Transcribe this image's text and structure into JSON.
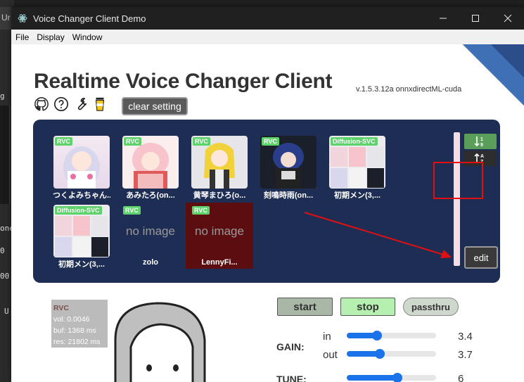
{
  "background": {
    "tab_text": "Ur",
    "side_texts": [
      "g",
      "one",
      "0",
      "00",
      "U"
    ]
  },
  "window": {
    "title": "Voice Changer Client Demo"
  },
  "menu": [
    "File",
    "Display",
    "Window"
  ],
  "header": {
    "title": "Realtime Voice Changer Client",
    "version": "v.1.5.3.12a  onnxdirectML-cuda",
    "icons": [
      "github-icon",
      "help-icon",
      "wrench-icon",
      "coffee-icon"
    ],
    "clear_setting": "clear setting"
  },
  "models": [
    {
      "badge": "RVC",
      "label": "つくよみちゃん..."
    },
    {
      "badge": "RVC",
      "label": "あみたろ(on..."
    },
    {
      "badge": "RVC",
      "label": "黄琴まひろ(o..."
    },
    {
      "badge": "RVC",
      "label": "刻鳴時雨(on..."
    },
    {
      "badge": "Diffusion-SVC",
      "label": "初期メン(3,..."
    },
    {
      "badge": "Diffusion-SVC",
      "label": "初期メン(3,..."
    },
    {
      "badge": "RVC",
      "label": "zolo",
      "image_text": "no image"
    },
    {
      "badge": "RVC",
      "label": "LennyFi...",
      "image_text": "no image"
    }
  ],
  "panel": {
    "sort_up_icon": "sort-desc-icon",
    "sort_down_icon": "sort-asc-icon",
    "edit": "edit"
  },
  "stats": {
    "model_type": "RVC",
    "vol": "vol: 0.0046",
    "buf": "buf: 1368 ms",
    "res": "res: 21802 ms"
  },
  "controls": {
    "start": "start",
    "stop": "stop",
    "passthru": "passthru",
    "gain_label": "GAIN:",
    "in_label": "in",
    "out_label": "out",
    "gain_in": "3.4",
    "gain_out": "3.7",
    "tune_label": "TUNE:",
    "tune_value": "6",
    "gain_in_fraction": 0.34,
    "gain_out_fraction": 0.37,
    "tune_fraction": 0.57
  },
  "colors": {
    "panel": "#1e2d54",
    "rvc_badge": "#5ed26b",
    "start_btn": "#a9b8a6",
    "stop_btn": "#b6f0b1",
    "slider": "#1a73e8",
    "highlight": "#e01010"
  }
}
